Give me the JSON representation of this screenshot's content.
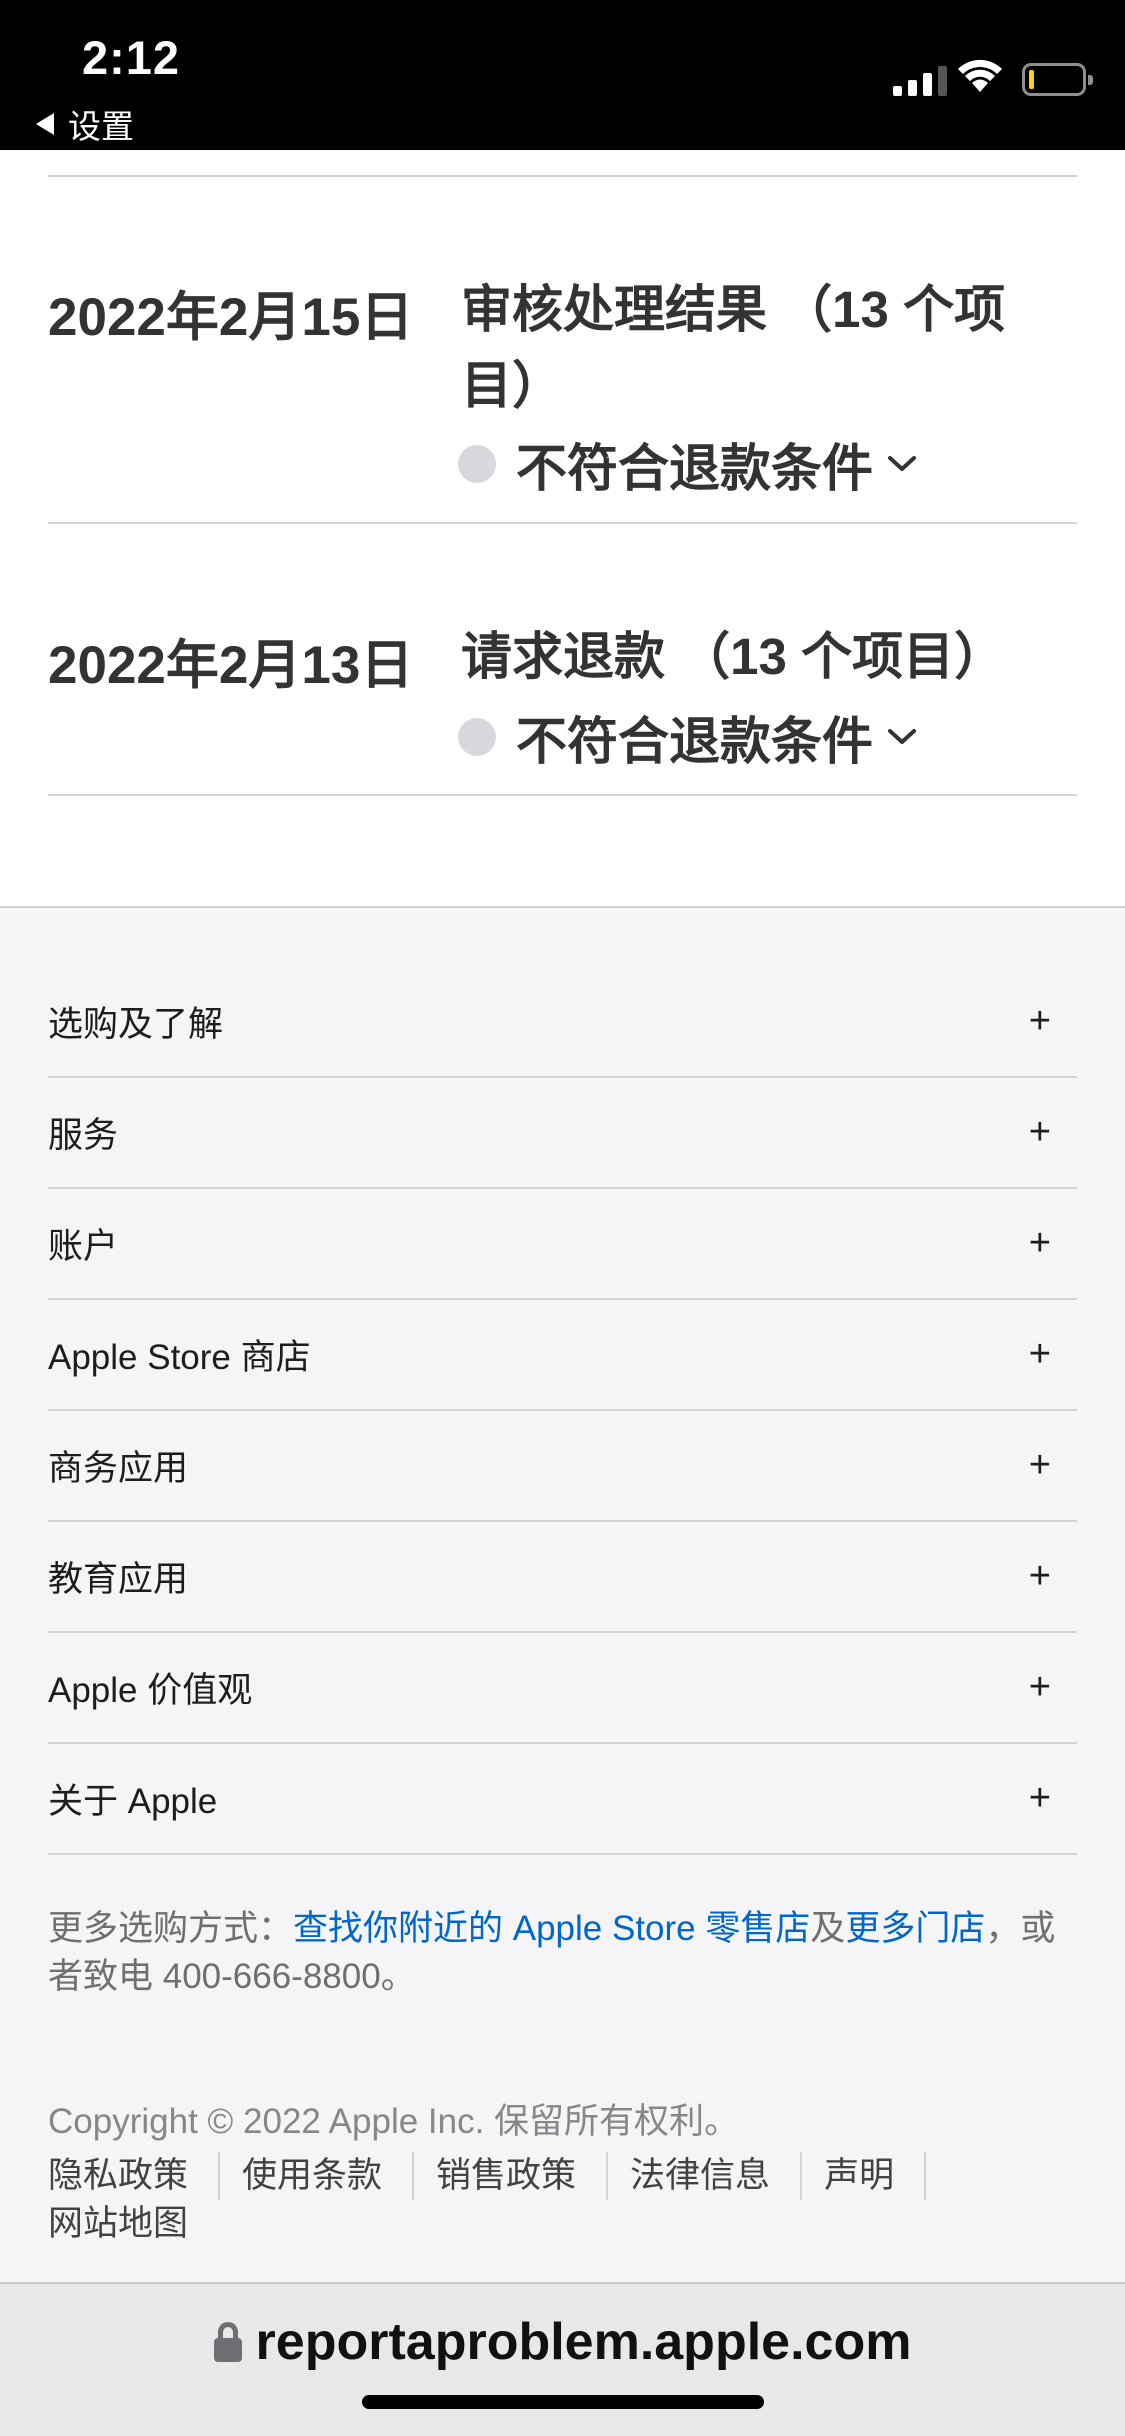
{
  "status_bar": {
    "time": "2:12",
    "back_label": "设置"
  },
  "entries": [
    {
      "date": "2022年2月15日",
      "title": "审核处理结果 （13 个项目）",
      "status": "不符合退款条件"
    },
    {
      "date": "2022年2月13日",
      "title": "请求退款 （13 个项目）",
      "status": "不符合退款条件"
    }
  ],
  "footer": {
    "accordion": [
      {
        "label": "选购及了解",
        "icon": "plus-icon"
      },
      {
        "label": "服务",
        "icon": "plus-icon"
      },
      {
        "label": "账户",
        "icon": "plus-icon"
      },
      {
        "label": "Apple Store 商店",
        "icon": "plus-icon"
      },
      {
        "label": "商务应用",
        "icon": "plus-icon"
      },
      {
        "label": "教育应用",
        "icon": "plus-icon"
      },
      {
        "label": "Apple 价值观",
        "icon": "plus-icon"
      },
      {
        "label": "关于 Apple",
        "icon": "plus-icon"
      }
    ],
    "plus_symbol": "+",
    "more_ways": {
      "prefix": "更多选购方式：",
      "link1": "查找你附近的 Apple Store 零售店",
      "middle": "及",
      "link2": "更多门店",
      "suffix": "，或者致电 400-666-8800。"
    },
    "copyright": "Copyright © 2022 Apple Inc. 保留所有权利。",
    "legal_links": [
      "隐私政策",
      "使用条款",
      "销售政策",
      "法律信息",
      "声明",
      "网站地图"
    ]
  },
  "browser": {
    "url": "reportaproblem.apple.com"
  },
  "colors": {
    "link": "#0066cc",
    "footer_bg": "#f5f5f7",
    "status_dot": "#d8d8dc"
  }
}
